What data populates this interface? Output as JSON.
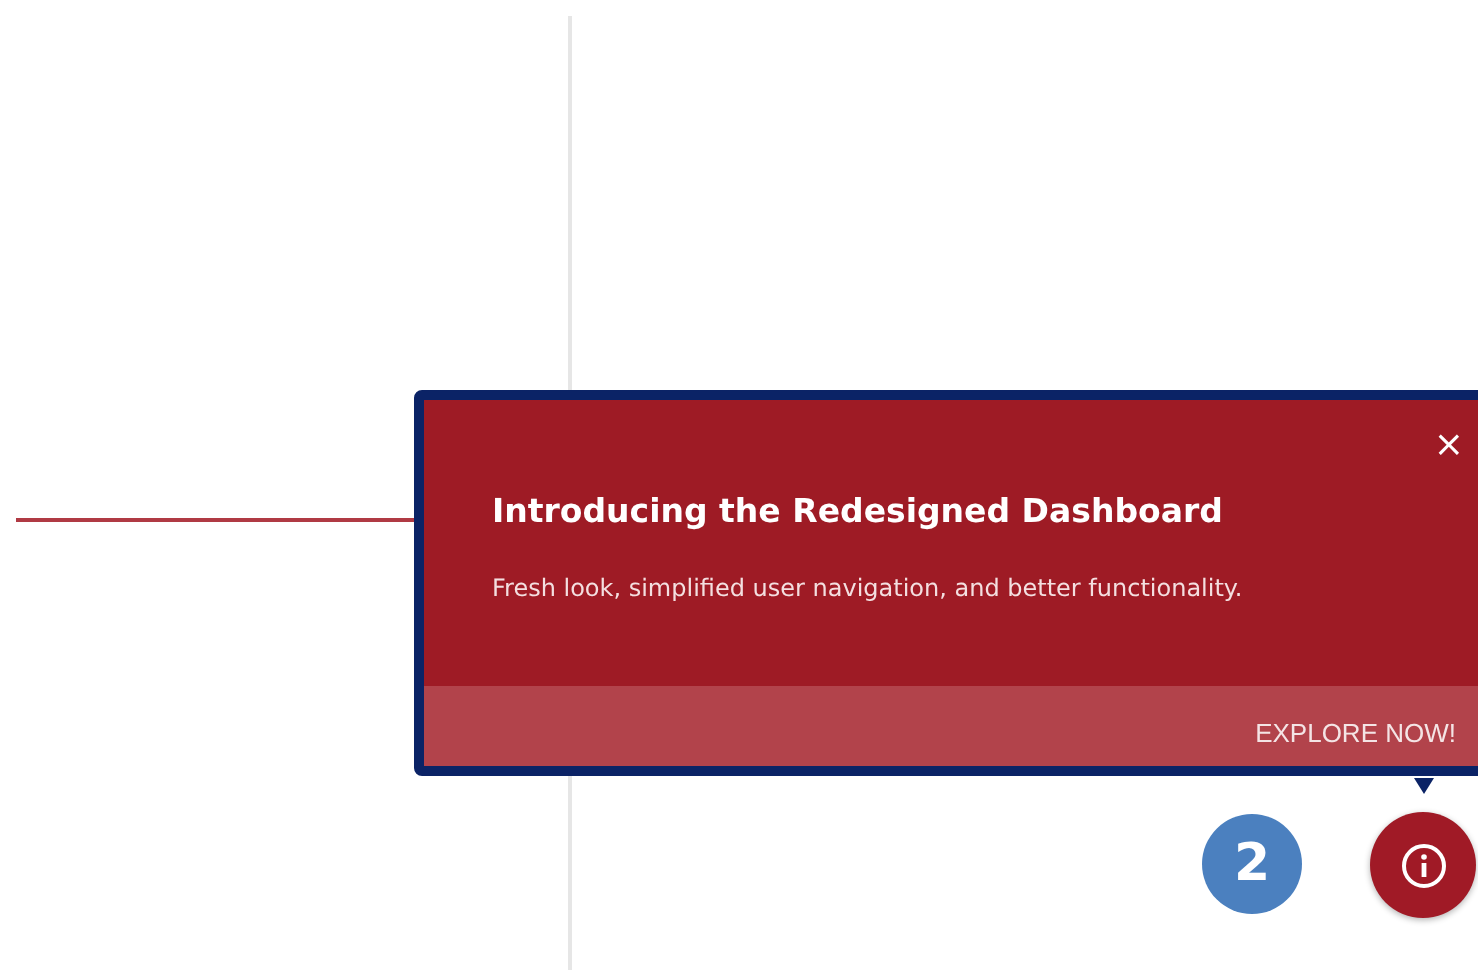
{
  "popup": {
    "title": "Introducing the Redesigned Dashboard",
    "message": "Fresh look, simplified user navigation, and better functionality.",
    "close": "×",
    "action": "EXPLORE NOW!"
  },
  "step_badge": "2"
}
